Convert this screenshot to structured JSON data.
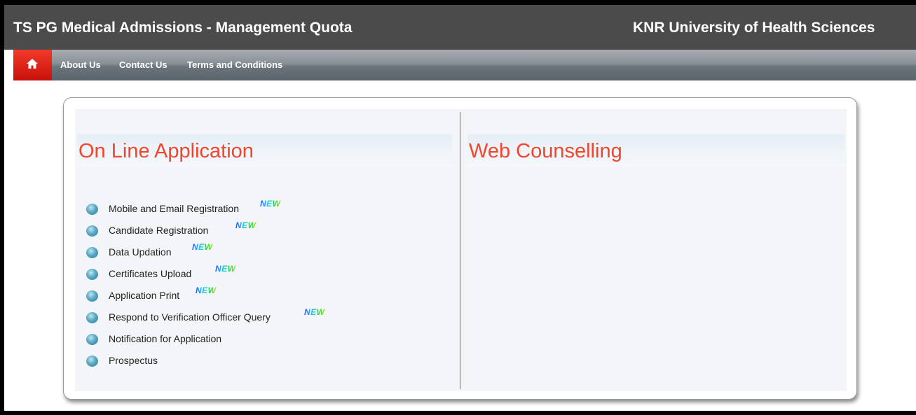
{
  "header": {
    "title": "TS PG Medical Admissions - Management Quota",
    "university": "KNR University of Health Sciences"
  },
  "nav": {
    "home_icon": "home-icon",
    "links": [
      {
        "label": "About Us"
      },
      {
        "label": "Contact Us"
      },
      {
        "label": "Terms and Conditions"
      }
    ]
  },
  "online_application": {
    "heading": "On Line Application",
    "items": [
      {
        "label": "Mobile and Email Registration",
        "badge": "NEW"
      },
      {
        "label": "Candidate Registration",
        "badge": "NEW"
      },
      {
        "label": "Data Updation",
        "badge": "NEW"
      },
      {
        "label": "Certificates Upload",
        "badge": "NEW"
      },
      {
        "label": "Application Print",
        "badge": "NEW"
      },
      {
        "label": "Respond to Verification Officer Query",
        "badge": "NEW"
      },
      {
        "label": "Notification for Application"
      },
      {
        "label": "Prospectus"
      }
    ]
  },
  "web_counselling": {
    "heading": "Web Counselling"
  },
  "colors": {
    "title_bar": "#4b4b4b",
    "home_button": "#e0231a",
    "heading_text": "#f2452d"
  }
}
